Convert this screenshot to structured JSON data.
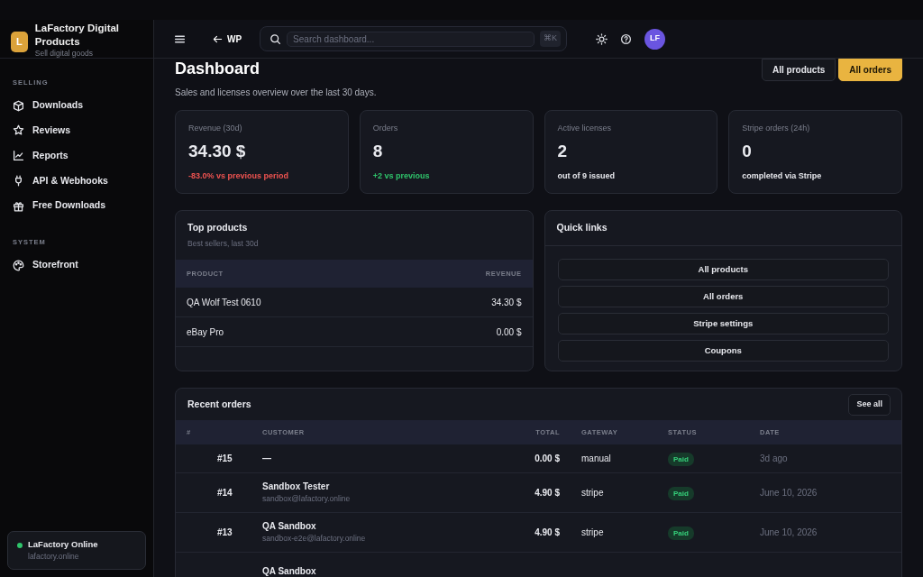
{
  "sidebar": {
    "brand": {
      "initial": "L",
      "name": "LaFactory Digital Products",
      "tagline": "Sell digital goods"
    },
    "sections": [
      {
        "title": "SELLING",
        "items": [
          {
            "label": "Downloads"
          },
          {
            "label": "Reviews"
          },
          {
            "label": "Reports"
          },
          {
            "label": "API & Webhooks"
          },
          {
            "label": "Free Downloads"
          }
        ]
      },
      {
        "title": "SYSTEM",
        "items": [
          {
            "label": "Storefront"
          }
        ]
      }
    ],
    "site": {
      "name": "LaFactory Online",
      "url": "lafactory.online",
      "online": true
    }
  },
  "header": {
    "back_link": "WP",
    "search": {
      "placeholder": "Search dashboard..."
    },
    "shortcut": "⌘K",
    "avatar": "LF"
  },
  "page": {
    "title": "Dashboard",
    "subtitle": "Sales and licenses overview over the last 30 days.",
    "actions": [
      {
        "label": "All products",
        "kind": "secondary"
      },
      {
        "label": "All orders",
        "kind": "primary"
      }
    ]
  },
  "stats": [
    {
      "label": "Revenue (30d)",
      "value": "34.30 $",
      "note": "-83.0% vs previous period",
      "color": "#ef5350"
    },
    {
      "label": "Orders",
      "value": "8",
      "note": "+2 vs previous",
      "color": "#2fc46b"
    },
    {
      "label": "Active licenses",
      "value": "2",
      "note": "out of 9 issued",
      "color": "#e6e7ec"
    },
    {
      "label": "Stripe orders (24h)",
      "value": "0",
      "note": "completed via Stripe",
      "color": "#e6e7ec"
    }
  ],
  "top_products": {
    "title": "Top products",
    "subtitle": "Best sellers, last 30d",
    "columns": [
      "PRODUCT",
      "REVENUE"
    ],
    "rows": [
      {
        "product": "QA Wolf Test 0610",
        "revenue": "34.30 $"
      },
      {
        "product": "eBay Pro",
        "revenue": "0.00 $"
      }
    ]
  },
  "quick_links": {
    "title": "Quick links",
    "links": [
      "All products",
      "All orders",
      "Stripe settings",
      "Coupons"
    ]
  },
  "recent_orders": {
    "title": "Recent orders",
    "button": "See all",
    "columns": [
      "#",
      "CUSTOMER",
      "TOTAL",
      "GATEWAY",
      "STATUS",
      "DATE"
    ],
    "rows": [
      {
        "number": "#15",
        "customer": "—",
        "total": "0.00 $",
        "gateway": "manual",
        "status": "Paid",
        "date": "3d ago"
      },
      {
        "number": "#14",
        "customer": "Sandbox Tester",
        "email": "sandbox@lafactory.online",
        "total": "4.90 $",
        "gateway": "stripe",
        "status": "Paid",
        "date": "June 10, 2026"
      },
      {
        "number": "#13",
        "customer": "QA Sandbox",
        "email": "sandbox-e2e@lafactory.online",
        "total": "4.90 $",
        "gateway": "stripe",
        "status": "Paid",
        "date": "June 10, 2026"
      },
      {
        "customer": "QA Sandbox"
      }
    ]
  }
}
